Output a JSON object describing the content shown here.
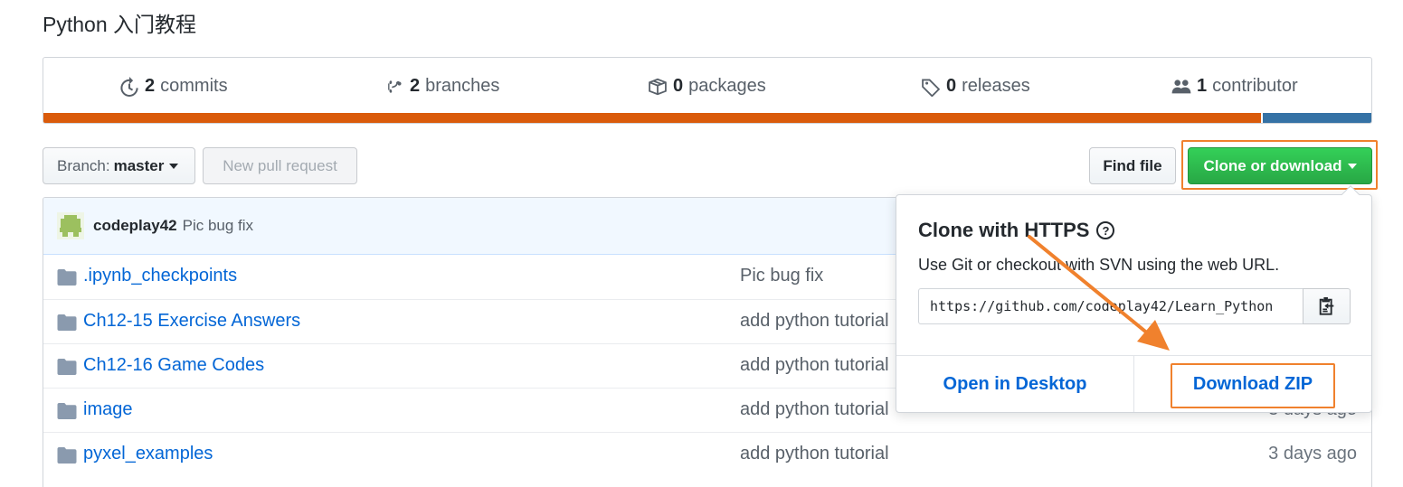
{
  "repo": {
    "description": "Python 入门教程"
  },
  "stats": [
    {
      "icon": "history-icon",
      "count": "2",
      "label": "commits"
    },
    {
      "icon": "branch-icon",
      "count": "2",
      "label": "branches"
    },
    {
      "icon": "package-icon",
      "count": "0",
      "label": "packages"
    },
    {
      "icon": "tag-icon",
      "count": "0",
      "label": "releases"
    },
    {
      "icon": "people-icon",
      "count": "1",
      "label": "contributor"
    }
  ],
  "language_bar": [
    {
      "color": "#DA5B0B",
      "share": 0.917
    },
    {
      "color": "#3572A5",
      "share": 0.083
    }
  ],
  "toolbar": {
    "branch_prefix": "Branch:",
    "branch_name": "master",
    "new_pr": "New pull request",
    "find_file": "Find file",
    "clone": "Clone or download"
  },
  "latest_commit": {
    "author": "codeplay42",
    "message": "Pic bug fix"
  },
  "files": [
    {
      "name": ".ipynb_checkpoints",
      "commit": "Pic bug fix",
      "age": ""
    },
    {
      "name": "Ch12-15 Exercise Answers",
      "commit": "add python tutorial",
      "age": ""
    },
    {
      "name": "Ch12-16 Game Codes",
      "commit": "add python tutorial",
      "age": ""
    },
    {
      "name": "image",
      "commit": "add python tutorial",
      "age": "3 days ago"
    },
    {
      "name": "pyxel_examples",
      "commit": "add python tutorial",
      "age": "3 days ago"
    }
  ],
  "clone_panel": {
    "title": "Clone with HTTPS",
    "help": "?",
    "description": "Use Git or checkout with SVN using the web URL.",
    "url": "https://github.com/codeplay42/Learn_Python",
    "open_desktop": "Open in Desktop",
    "download_zip": "Download ZIP"
  },
  "annotation_color": "#F0812D"
}
